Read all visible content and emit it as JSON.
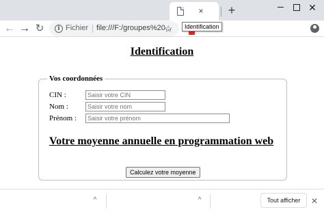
{
  "browser": {
    "tab": {
      "icon": "document-icon",
      "close_glyph": "×"
    },
    "new_tab_glyph": "+",
    "window": {
      "minimize": "minimize-icon",
      "maximize": "maximize-icon",
      "close_glyph": "✕"
    },
    "nav": {
      "back_glyph": "←",
      "forward_glyph": "→",
      "reload_glyph": "↻"
    },
    "omnibox": {
      "info_glyph": "i",
      "scheme_label": "Fichier",
      "url": "file:///F:/groupes%20...",
      "star_glyph": "☆"
    },
    "tooltip": "Identification"
  },
  "page": {
    "title": "Identification",
    "fieldset_legend": "Vos coordonnées",
    "fields": [
      {
        "label": "CIN :",
        "placeholder": "Saisir votre CIN"
      },
      {
        "label": "Nom :",
        "placeholder": "Saisir votre nom"
      },
      {
        "label": "Prénom :",
        "placeholder": "Saisir votre prénom"
      }
    ],
    "heading": "Votre moyenne annuelle en programmation web",
    "button_label": "Calculez votre moyenne"
  },
  "download_shelf": {
    "chevron_glyph": "^",
    "show_all": "Tout afficher",
    "close_glyph": "✕"
  }
}
